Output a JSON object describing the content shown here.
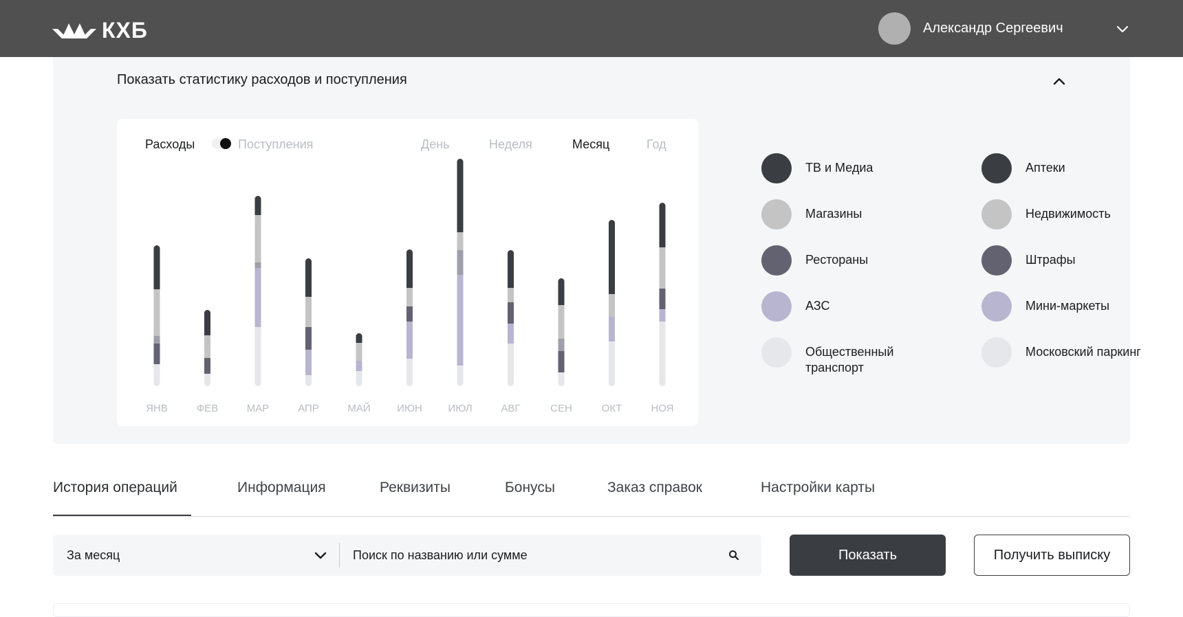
{
  "header": {
    "logo_text": "КХБ",
    "user_name": "Александр Сергеевич"
  },
  "stats": {
    "title": "Показать статистику расходов и поступления",
    "mode_expenses": "Расходы",
    "mode_income": "Поступления",
    "periods": [
      "День",
      "Неделя",
      "Месяц",
      "Год"
    ],
    "active_period": "Месяц"
  },
  "legend": [
    {
      "label": "ТВ и Медиа",
      "color": "#3a3d41"
    },
    {
      "label": "Аптеки",
      "color": "#3a3d41"
    },
    {
      "label": "Магазины",
      "color": "#c4c4c4"
    },
    {
      "label": "Недвижимость",
      "color": "#c4c4c4"
    },
    {
      "label": "Рестораны",
      "color": "#636270"
    },
    {
      "label": "Штрафы",
      "color": "#636270"
    },
    {
      "label": "АЗС",
      "color": "#b8b5d0"
    },
    {
      "label": "Мини-маркеты",
      "color": "#b8b5d0"
    },
    {
      "label": "Общественный транспорт",
      "color": "#e6e7ea"
    },
    {
      "label": "Московский паркинг",
      "color": "#e6e7ea"
    }
  ],
  "chart_data": {
    "type": "bar",
    "stacked": true,
    "categories": [
      "ЯНВ",
      "ФЕВ",
      "МАР",
      "АПР",
      "МАЙ",
      "ИЮН",
      "ИЮЛ",
      "АВГ",
      "СЕН",
      "ОКТ",
      "НОЯ"
    ],
    "colors": [
      "#3a3d41",
      "#c4c4c4",
      "#9f9eab",
      "#636270",
      "#b8b5d0",
      "#e6e7ea"
    ],
    "series": [
      {
        "values": [
          64,
          37,
          28,
          56,
          14,
          56,
          107,
          55,
          39,
          108,
          65
        ]
      },
      {
        "values": [
          68,
          33,
          69,
          44,
          26,
          27,
          26,
          21,
          49,
          33,
          60
        ]
      },
      {
        "values": [
          11,
          0,
          8,
          0,
          0,
          0,
          36,
          0,
          18,
          0,
          0
        ]
      },
      {
        "values": [
          30,
          23,
          0,
          33,
          0,
          22,
          0,
          31,
          31,
          0,
          30
        ]
      },
      {
        "values": [
          0,
          0,
          86,
          37,
          15,
          54,
          132,
          29,
          0,
          36,
          18
        ]
      },
      {
        "values": [
          32,
          18,
          86,
          16,
          22,
          40,
          30,
          62,
          20,
          65,
          94
        ]
      }
    ]
  },
  "tabs": [
    "История операций",
    "Информация",
    "Реквизиты",
    "Бонусы",
    "Заказ справок",
    "Настройки карты"
  ],
  "filter": {
    "period_value": "За месяц",
    "search_placeholder": "Поиск по названию или сумме"
  },
  "buttons": {
    "show": "Показать",
    "statement": "Получить выписку"
  }
}
